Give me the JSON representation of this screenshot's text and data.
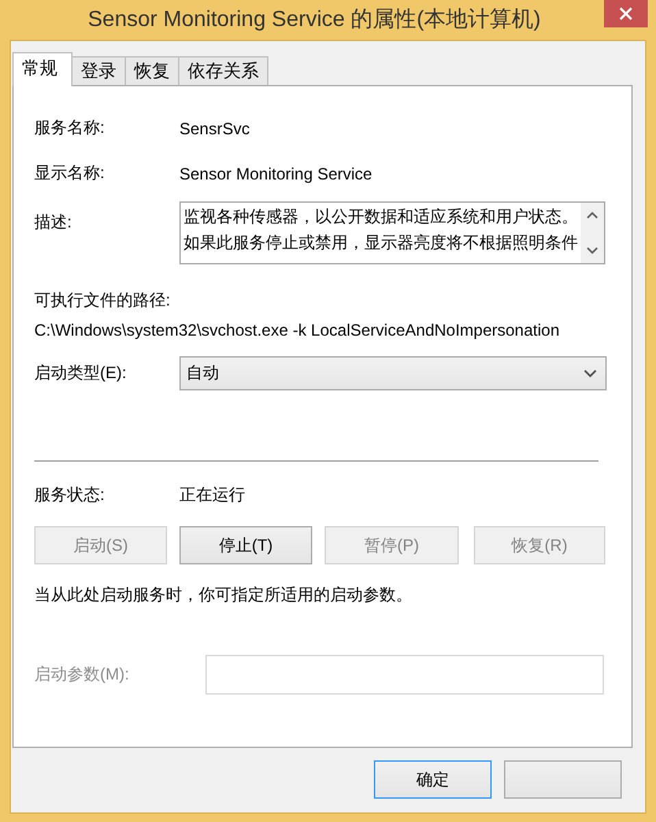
{
  "window": {
    "title": "Sensor Monitoring Service 的属性(本地计算机)"
  },
  "tabs": [
    {
      "label": "常规",
      "selected": true
    },
    {
      "label": "登录",
      "selected": false
    },
    {
      "label": "恢复",
      "selected": false
    },
    {
      "label": "依存关系",
      "selected": false
    }
  ],
  "service_name": {
    "label": "服务名称:",
    "value": "SensrSvc"
  },
  "display_name": {
    "label": "显示名称:",
    "value": "Sensor Monitoring Service"
  },
  "description": {
    "label": "描述:",
    "lines": [
      "监视各种传感器，以公开数据和适应系统和用户状态。",
      "如果此服务停止或禁用，显示器亮度将不根据照明条件"
    ]
  },
  "executable_path": {
    "label": "可执行文件的路径:",
    "value": "C:\\Windows\\system32\\svchost.exe -k LocalServiceAndNoImpersonation"
  },
  "startup_type": {
    "label": "启动类型(E):",
    "value": "自动"
  },
  "service_status": {
    "label": "服务状态:",
    "value": "正在运行"
  },
  "service_buttons": [
    {
      "label": "启动(S)",
      "disabled": true
    },
    {
      "label": "停止(T)",
      "disabled": false
    },
    {
      "label": "暂停(P)",
      "disabled": true
    },
    {
      "label": "恢复(R)",
      "disabled": true
    }
  ],
  "note": "当从此处启动服务时，你可指定所适用的启动参数。",
  "start_parameters": {
    "label": "启动参数(M):",
    "disabled": true
  },
  "dialog_buttons": [
    {
      "label": "确定",
      "focused": true
    },
    {
      "focused": false
    }
  ]
}
